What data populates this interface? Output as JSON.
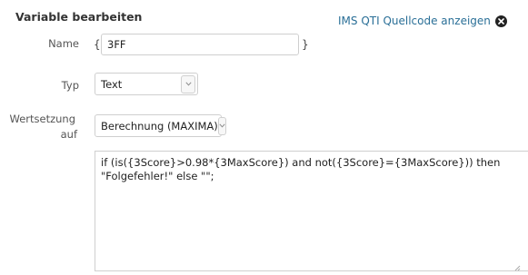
{
  "dialog": {
    "title": "Variable bearbeiten",
    "source_link": "IMS QTI Quellcode anzeigen"
  },
  "fields": {
    "name": {
      "label": "Name",
      "brace_open": "{",
      "brace_close": "}",
      "value": "3FF"
    },
    "type": {
      "label": "Typ",
      "selected": "Text"
    },
    "assignment": {
      "label_line1": "Wertsetzung",
      "label_line2": "auf",
      "selected": "Berechnung (MAXIMA)"
    },
    "expression": "if (is({3Score}>0.98*{3MaxScore}) and not({3Score}={3MaxScore})) then \"Folgefehler!\" else \"\";"
  },
  "icons": {
    "close": "close-circle-icon",
    "dropdown": "chevron-down-icon",
    "resize": "resize-grip-icon"
  },
  "colors": {
    "link": "#2a6f97",
    "border": "#cfcfcf",
    "text": "#333333"
  }
}
